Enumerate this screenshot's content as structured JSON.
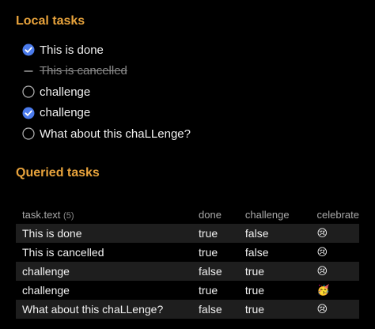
{
  "local_tasks": {
    "heading": "Local tasks",
    "items": [
      {
        "text": "This is done",
        "state": "done"
      },
      {
        "text": "This is cancelled",
        "state": "cancelled"
      },
      {
        "text": "challenge",
        "state": "open"
      },
      {
        "text": "challenge",
        "state": "done"
      },
      {
        "text": "What about this chaLLenge?",
        "state": "open"
      }
    ]
  },
  "queried_tasks": {
    "heading": "Queried tasks",
    "columns": {
      "text": "task.text",
      "count": "(5)",
      "done": "done",
      "challenge": "challenge",
      "celebrate": "celebrate"
    },
    "rows": [
      {
        "text": "This is done",
        "done": "true",
        "challenge": "false",
        "celebrate": "😢"
      },
      {
        "text": "This is cancelled",
        "done": "true",
        "challenge": "false",
        "celebrate": "😢"
      },
      {
        "text": "challenge",
        "done": "false",
        "challenge": "true",
        "celebrate": "😢"
      },
      {
        "text": "challenge",
        "done": "true",
        "challenge": "true",
        "celebrate": "🥳"
      },
      {
        "text": "What about this chaLLenge?",
        "done": "false",
        "challenge": "true",
        "celebrate": "😢"
      }
    ]
  },
  "colors": {
    "heading": "#e8a33c",
    "checkbox_done": "#4b7bec",
    "row_stripe": "#1e1e1e"
  },
  "icons": {
    "done": "checked-circle-icon",
    "cancelled": "dash-icon",
    "open": "empty-circle-icon"
  }
}
